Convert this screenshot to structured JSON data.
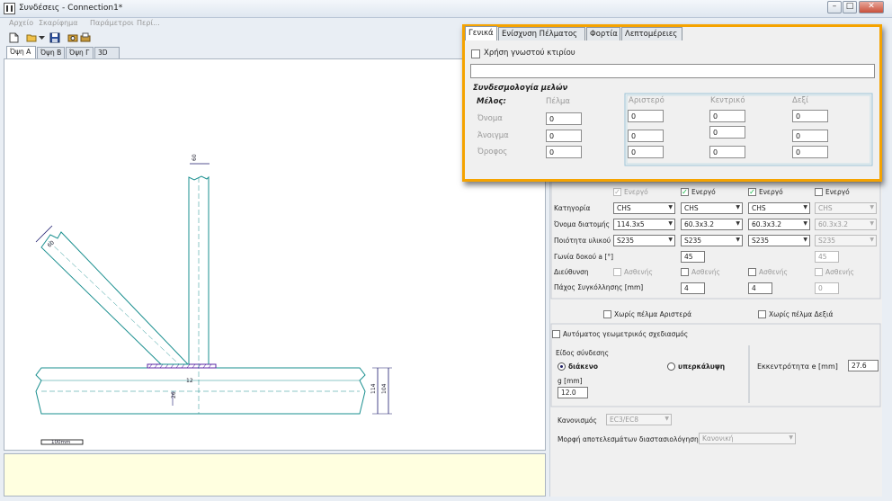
{
  "window": {
    "title": "Συνδέσεις - Connection1*",
    "buttons": {
      "minimize": "–",
      "restore": "□",
      "close": "✕"
    }
  },
  "menu": [
    "Αρχείο",
    "Σκαρίφημα",
    "Παράμετροι",
    "Περί..."
  ],
  "view_tabs": [
    "Όψη Α",
    "Όψη Β",
    "Όψη Γ",
    "3D"
  ],
  "drawing": {
    "dims": {
      "top": "60",
      "left": "60",
      "h1": "114",
      "h2": "104",
      "e": "12",
      "g": "26"
    },
    "scale_label": "100mm"
  },
  "popup": {
    "tabs": [
      "Γενικά",
      "Ενίσχυση Πέλματος",
      "Φορτία",
      "Λεπτομέρειες"
    ],
    "known_building_label": "Χρήση γνωστού κτιρίου",
    "known_building_value": "",
    "section_title": "Συνδεσμολογία μελών",
    "member_label": "Μέλος:",
    "flange_label": "Πέλμα",
    "rows": [
      "Όνομα",
      "Άνοιγμα",
      "Όροφος"
    ],
    "cols": [
      "Αριστερό",
      "Κεντρικό",
      "Δεξί"
    ],
    "values": {
      "flange": [
        "0",
        "0",
        "0"
      ],
      "left": [
        "0",
        "0",
        "0"
      ],
      "center": [
        "0",
        "0",
        "0"
      ],
      "right": [
        "0",
        "0",
        "0"
      ]
    }
  },
  "members": {
    "active_label": "Ενεργό",
    "row_labels": [
      "Κατηγορία",
      "Όνομα διατομής",
      "Ποιότητα υλικού",
      "Γωνία δοκού a [°]",
      "Διεύθυνση",
      "Πάχος Συγκόλλησης [mm]"
    ],
    "weak_label": "Ασθενής",
    "columns": [
      {
        "active": true,
        "enabled": false,
        "category": "CHS",
        "section": "114.3x5",
        "material": "S235",
        "angle": "",
        "weld": ""
      },
      {
        "active": true,
        "enabled": true,
        "category": "CHS",
        "section": "60.3x3.2",
        "material": "S235",
        "angle": "45",
        "weld": "4"
      },
      {
        "active": true,
        "enabled": true,
        "category": "CHS",
        "section": "60.3x3.2",
        "material": "S235",
        "angle": "",
        "weld": "4"
      },
      {
        "active": false,
        "enabled": false,
        "category": "CHS",
        "section": "60.3x3.2",
        "material": "S235",
        "angle": "45",
        "weld": "0"
      }
    ]
  },
  "options": {
    "no_flange_left": "Χωρίς πέλμα Αριστερά",
    "no_flange_right": "Χωρίς πέλμα Δεξιά",
    "auto_design": "Αυτόματος γεωμετρικός σχεδιασμός",
    "connection_type_label": "Είδος σύνδεσης",
    "gap_label": "διάκενο",
    "overlap_label": "υπερκάλυψη",
    "g_label": "g [mm]",
    "g_value": "12.0",
    "eccentricity_label": "Εκκεντρότητα  e [mm]",
    "eccentricity_value": "27.6",
    "code_label": "Κανονισμός",
    "code_value": "EC3/EC8",
    "results_label": "Μορφή αποτελεσμάτων διαστασιολόγησης",
    "results_value": "Κανονική"
  },
  "colors": {
    "accent_border": "#f5a300",
    "steel_line": "#1a8f8f",
    "weld_hatch": "#5b2aa6",
    "dim_line": "#1c1a6e"
  }
}
